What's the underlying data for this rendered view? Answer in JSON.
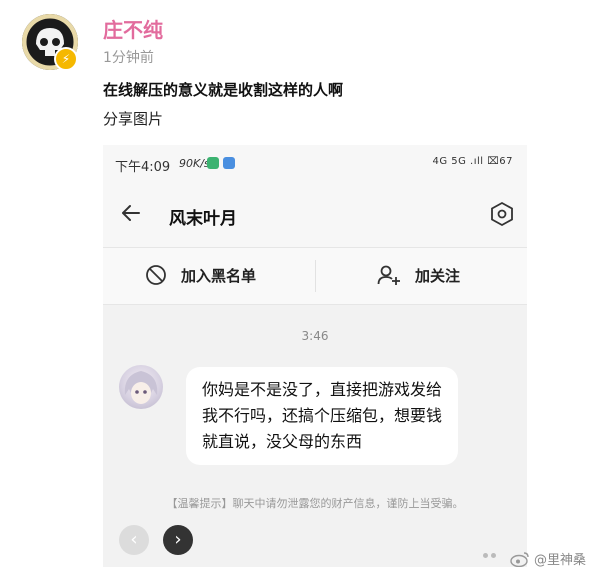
{
  "post": {
    "username": "庄不纯",
    "time": "1分钟前",
    "text": "在线解压的意义就是收割这样的人啊",
    "share_label": "分享图片"
  },
  "phone": {
    "status_time": "下午4:09",
    "status_speed": "90K/s",
    "status_right": "4G 5G .ıll ⌧67"
  },
  "chat": {
    "title": "风末叶月",
    "block_label": "加入黑名单",
    "follow_label": "加关注",
    "message_time": "3:46",
    "message": "你妈是不是没了，直接把游戏发给我不行吗，还搞个压缩包，想要钱就直说，没父母的东西",
    "tip": "【温馨提示】聊天中请勿泄露您的财产信息，谨防上当受骗。"
  },
  "nav": {
    "prev": "‹",
    "next": "›"
  },
  "watermark": "@里神桑",
  "icons": [
    "back-arrow-icon",
    "settings-hex-icon",
    "block-icon",
    "add-user-icon",
    "weibo-logo-icon",
    "verified-badge-icon"
  ],
  "colors": {
    "username": "#e26b9d",
    "badge": "#f5b800"
  }
}
